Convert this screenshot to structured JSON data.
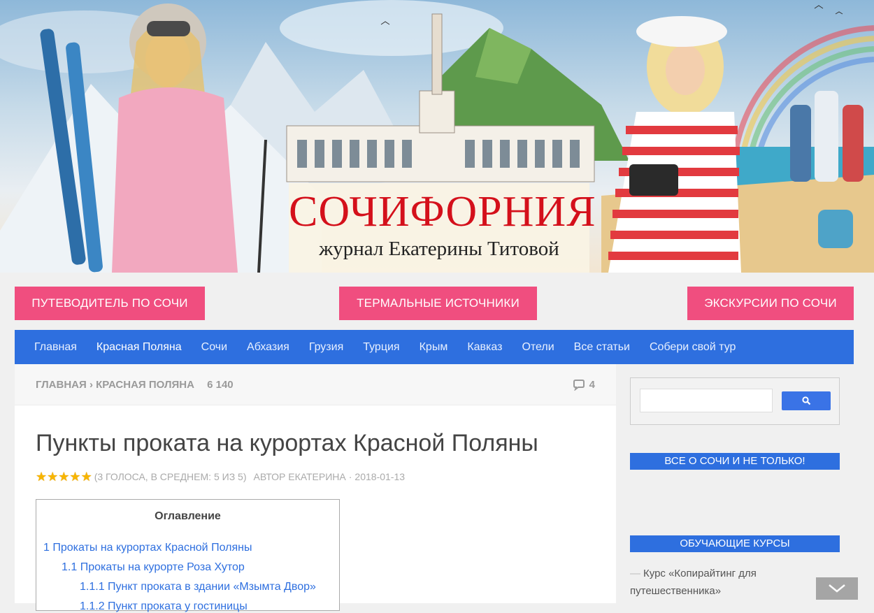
{
  "banner": {
    "title": "СОЧИФОРНИЯ",
    "subtitle": "журнал Екатерины Титовой"
  },
  "top_buttons": [
    {
      "label": "ПУТЕВОДИТЕЛЬ ПО СОЧИ"
    },
    {
      "label": "ТЕРМАЛЬНЫЕ ИСТОЧНИКИ"
    },
    {
      "label": "ЭКСКУРСИИ ПО СОЧИ"
    }
  ],
  "nav": {
    "items": [
      {
        "label": "Главная"
      },
      {
        "label": "Красная Поляна",
        "active": true
      },
      {
        "label": "Сочи"
      },
      {
        "label": "Абхазия"
      },
      {
        "label": "Грузия"
      },
      {
        "label": "Турция"
      },
      {
        "label": "Крым"
      },
      {
        "label": "Кавказ"
      },
      {
        "label": "Отели"
      },
      {
        "label": "Все статьи"
      },
      {
        "label": "Собери свой тур"
      }
    ]
  },
  "breadcrumb": {
    "home": "ГЛАВНАЯ",
    "separator": "›",
    "section": "КРАСНАЯ ПОЛЯНА",
    "views": "6 140",
    "comments": "4"
  },
  "article": {
    "title": "Пункты проката на курортах Красной Поляны",
    "rating_stars": 5,
    "rating_text": "(3 ГОЛОСА, В СРЕДНЕМ: 5 ИЗ 5)",
    "author": "АВТОР ЕКАТЕРИНА",
    "date_sep": "·",
    "date": "2018-01-13"
  },
  "toc": {
    "heading": "Оглавление",
    "items": [
      {
        "label": "1 Прокаты на курортах Красной Поляны"
      },
      {
        "label": "1.1 Прокаты на курорте Роза Хутор"
      },
      {
        "label": "1.1.1 Пункт проката в здании «Мзымта Двор»"
      },
      {
        "label": "1.1.2 Пункт проката у гостиницы"
      }
    ]
  },
  "sidebar": {
    "search_placeholder": "",
    "widget1_title": "ВСЕ О СОЧИ И НЕ ТОЛЬКО!",
    "widget2_title": "ОБУЧАЮЩИЕ КУРСЫ",
    "course_link": "Курс «Копирайтинг для путешественника»"
  },
  "colors": {
    "pink": "#f04e7f",
    "nav_blue": "#2e6fdf",
    "logo_red": "#d4101b"
  },
  "icons": [
    "search-icon",
    "comment-icon",
    "star-icon",
    "chevron-down-icon"
  ]
}
